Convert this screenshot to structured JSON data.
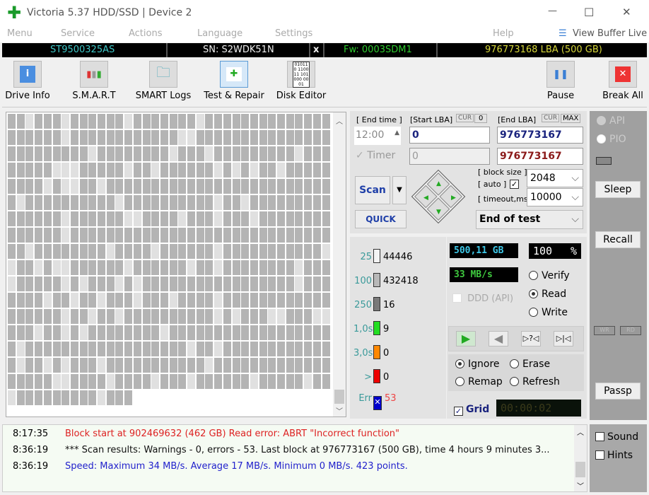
{
  "window": {
    "title": "Victoria 5.37 HDD/SSD | Device 2",
    "minimize": "—",
    "maximize": "☐",
    "close": "✕"
  },
  "menu": {
    "items": [
      "Menu",
      "Service",
      "Actions",
      "Language",
      "Settings"
    ],
    "help": "Help",
    "view_buffer": "View Buffer Live"
  },
  "drive": {
    "model": "ST9500325AS",
    "serial": "SN: S2WDK51N",
    "close": "x",
    "firmware": "Fw: 0003SDM1",
    "capacity": "976773168 LBA (500 GB)"
  },
  "toolbar": {
    "drive_info": "Drive Info",
    "smart": "S.M.A.R.T",
    "smart_logs": "SMART Logs",
    "test_repair": "Test & Repair",
    "disk_editor": "Disk Editor",
    "pause": "Pause",
    "break_all": "Break All",
    "disk_editor_icon_text": "010110 110011 101000 0001"
  },
  "test": {
    "end_time_label": "[ End time ]",
    "end_time": "12:00",
    "start_lba_label": "[Start LBA]",
    "cur": "CUR",
    "zero": "0",
    "end_lba_label": "[End LBA]",
    "max": "MAX",
    "start_lba": "0",
    "end_lba": "976773167",
    "timer_label": "Timer",
    "timer_value": "0",
    "end_lba2": "976773167",
    "scan": "Scan",
    "quick": "QUICK",
    "block_size_label": "[ block size ]",
    "auto_label": "[ auto ]",
    "timeout_label": "[ timeout,ms ]",
    "block_size": "2048",
    "timeout": "10000",
    "end_action": "End of test"
  },
  "legend": [
    {
      "label": "25",
      "count": "44446",
      "color": "#f4f4f4"
    },
    {
      "label": "100",
      "count": "432418",
      "color": "#b8b8b8"
    },
    {
      "label": "250",
      "count": "16",
      "color": "#7a7a7a"
    },
    {
      "label": "1,0s",
      "count": "9",
      "color": "#22dd22"
    },
    {
      "label": "3,0s",
      "count": "0",
      "color": "#ff8800"
    },
    {
      "label": ">",
      "count": "0",
      "color": "#ee0000"
    },
    {
      "label": "Err",
      "count": "53",
      "color": "#0000cc"
    }
  ],
  "status": {
    "size": "500,11 GB",
    "percent": "100",
    "pct_sign": "%",
    "speed": "33 MB/s",
    "ddd": "DDD (API)",
    "verify": "Verify",
    "read": "Read",
    "write": "Write",
    "ignore": "Ignore",
    "erase": "Erase",
    "remap": "Remap",
    "refresh": "Refresh",
    "grid": "Grid",
    "timer": "00:00:02"
  },
  "side": {
    "api": "API",
    "pio": "PIO",
    "sleep": "Sleep",
    "recall": "Recall",
    "wr": "WR",
    "rd": "RD",
    "passp": "Passp",
    "sound": "Sound",
    "hints": "Hints"
  },
  "log": [
    {
      "time": "8:17:35",
      "msg": "Block start at 902469632 (462 GB) Read error: ABRT \"Incorrect function\"",
      "color": "#dd2222"
    },
    {
      "time": "8:36:19",
      "msg": "*** Scan results: Warnings - 0, errors - 53. Last block at 976773167 (500 GB), time 4 hours 9 minutes 3...",
      "color": "#111111"
    },
    {
      "time": "8:36:19",
      "msg": "Speed: Maximum 34 MB/s. Average 17 MB/s. Minimum 0 MB/s. 423 points.",
      "color": "#2222cc"
    }
  ]
}
